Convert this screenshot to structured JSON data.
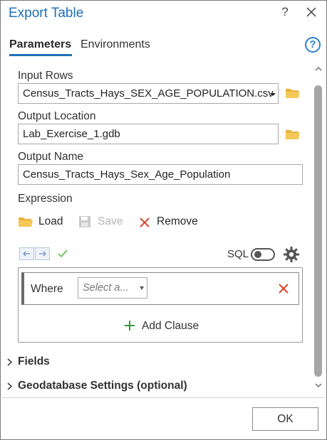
{
  "window": {
    "title": "Export Table",
    "help_glyph": "?",
    "close_icon": "close-icon"
  },
  "tabs": [
    {
      "label": "Parameters",
      "active": true
    },
    {
      "label": "Environments",
      "active": false
    }
  ],
  "help_circle_glyph": "?",
  "params": {
    "input_rows": {
      "label": "Input Rows",
      "value": "Census_Tracts_Hays_SEX_AGE_POPULATION.csv"
    },
    "output_location": {
      "label": "Output Location",
      "value": "Lab_Exercise_1.gdb"
    },
    "output_name": {
      "label": "Output Name",
      "value": "Census_Tracts_Hays_Sex_Age_Population"
    }
  },
  "expression": {
    "label": "Expression",
    "load_label": "Load",
    "save_label": "Save",
    "remove_label": "Remove",
    "sql_label": "SQL",
    "sql_enabled": false,
    "clause": {
      "where_label": "Where",
      "select_placeholder": "Select a..."
    },
    "add_clause_label": "Add Clause"
  },
  "sections": [
    {
      "label": "Fields",
      "expanded": false
    },
    {
      "label": "Geodatabase Settings (optional)",
      "expanded": false
    }
  ],
  "footer": {
    "ok_label": "OK"
  },
  "colors": {
    "accent": "#1e6fb8",
    "folder": "#e8b23a",
    "remove_x": "#d9452b",
    "add_plus": "#2e9b3d",
    "check": "#6bbf59"
  }
}
